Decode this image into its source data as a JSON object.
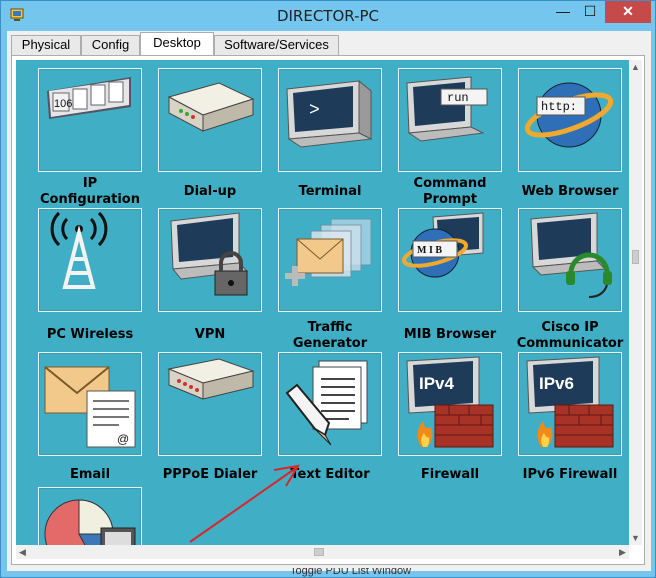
{
  "window": {
    "title": "DIRECTOR-PC",
    "controls": {
      "minimize": "—",
      "maximize": "☐",
      "close": "✕"
    }
  },
  "tabs": [
    {
      "label": "Physical",
      "active": false
    },
    {
      "label": "Config",
      "active": false
    },
    {
      "label": "Desktop",
      "active": true
    },
    {
      "label": "Software/Services",
      "active": false
    }
  ],
  "apps": [
    {
      "name": "ip-configuration",
      "label": "IP\nConfiguration",
      "icon": "ip-config-icon",
      "image_text": "106"
    },
    {
      "name": "dial-up",
      "label": "Dial-up",
      "icon": "modem-icon"
    },
    {
      "name": "terminal",
      "label": "Terminal",
      "icon": "terminal-icon",
      "image_text": ">"
    },
    {
      "name": "command-prompt",
      "label": "Command\nPrompt",
      "icon": "command-prompt-icon",
      "image_text": "run"
    },
    {
      "name": "web-browser",
      "label": "Web Browser",
      "icon": "web-browser-icon",
      "image_text": "http:"
    },
    {
      "name": "pc-wireless",
      "label": "PC Wireless",
      "icon": "wireless-antenna-icon"
    },
    {
      "name": "vpn",
      "label": "VPN",
      "icon": "vpn-lock-icon"
    },
    {
      "name": "traffic-generator",
      "label": "Traffic\nGenerator",
      "icon": "traffic-generator-icon"
    },
    {
      "name": "mib-browser",
      "label": "MIB Browser",
      "icon": "mib-browser-icon",
      "image_text": "M I B"
    },
    {
      "name": "cisco-ip-communicator",
      "label": "Cisco IP\nCommunicator",
      "icon": "ip-communicator-icon"
    },
    {
      "name": "email",
      "label": "Email",
      "icon": "email-icon"
    },
    {
      "name": "pppoe-dialer",
      "label": "PPPoE Dialer",
      "icon": "pppoe-dialer-icon"
    },
    {
      "name": "text-editor",
      "label": "Text Editor",
      "icon": "text-editor-icon"
    },
    {
      "name": "firewall",
      "label": "Firewall",
      "icon": "firewall-icon",
      "image_text": "IPv4"
    },
    {
      "name": "ipv6-firewall",
      "label": "IPv6 Firewall",
      "icon": "ipv6-firewall-icon",
      "image_text": "IPv6"
    },
    {
      "name": "partial-app",
      "label": "",
      "icon": "pie-chart-icon"
    }
  ],
  "background_text": "Toggle PDU List Window",
  "colors": {
    "window_frame": "#75c6ee",
    "desktop_bg": "#40aec4",
    "close_button": "#c74a4a",
    "annotation_arrow": "#d9262b"
  }
}
